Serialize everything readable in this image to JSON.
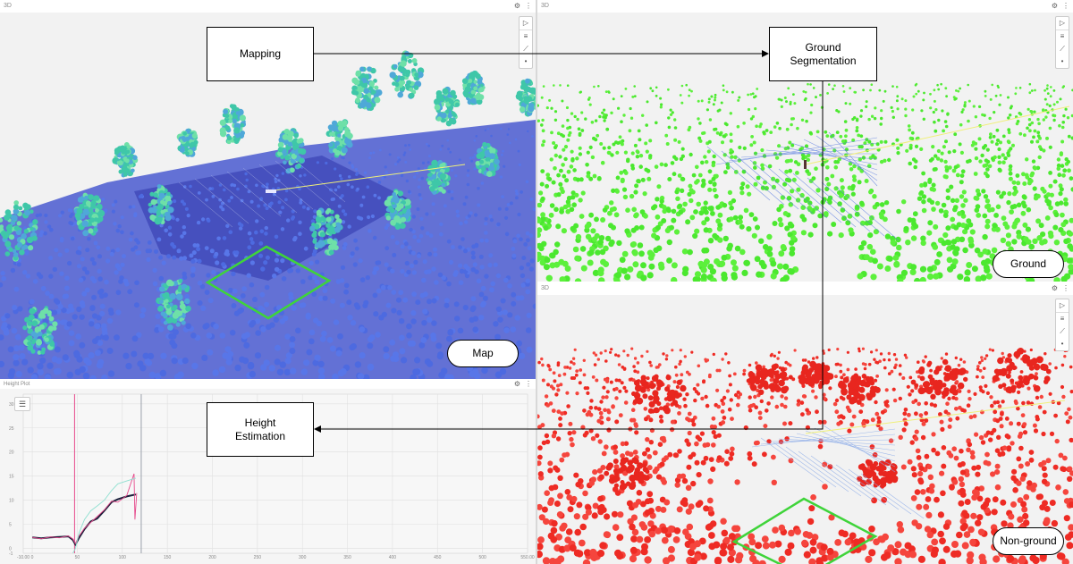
{
  "panels": {
    "map": {
      "title": "3D",
      "label": "Map",
      "color": "#4a62d8"
    },
    "ground": {
      "title": "3D",
      "label": "Ground",
      "color": "#44e82e"
    },
    "nonground": {
      "title": "3D",
      "label": "Non-ground",
      "color": "#ee2b24"
    },
    "height_plot": {
      "title": "Height Plot"
    }
  },
  "header_icons": {
    "settings": "⚙",
    "more": "⋮"
  },
  "toolbar_icons": [
    "cursor-icon",
    "layers-icon",
    "ruler-icon",
    "dot-icon"
  ],
  "pipeline": {
    "mapping": "Mapping",
    "ground_segmentation_line1": "Ground",
    "ground_segmentation_line2": "Segmentation",
    "height_estimation_line1": "Height",
    "height_estimation_line2": "Estimation"
  },
  "chart_data": {
    "type": "line",
    "x_ticks": [
      "-10.00",
      "0",
      "50",
      "100",
      "150",
      "200",
      "250",
      "300",
      "350",
      "400",
      "450",
      "500",
      "550.00"
    ],
    "y_ticks": [
      "30",
      "25",
      "20",
      "15",
      "10",
      "5",
      "0",
      "-1"
    ],
    "xlim": [
      -10,
      550
    ],
    "ylim": [
      -1,
      32
    ],
    "series": [
      {
        "color": "#1a1f3a",
        "x": [
          0,
          10,
          20,
          30,
          40,
          45,
          48,
          52,
          58,
          65,
          72,
          80,
          88,
          95,
          105,
          115
        ],
        "y": [
          2.3,
          2.1,
          2.3,
          2.4,
          2.5,
          1.8,
          0.8,
          2.2,
          4.0,
          5.6,
          6.2,
          7.8,
          9.6,
          10.2,
          10.8,
          11.2
        ]
      },
      {
        "color": "#e64b8c",
        "x": [
          0,
          10,
          20,
          30,
          40,
          45,
          48,
          52,
          58,
          65,
          72,
          80,
          88,
          95,
          105,
          113,
          114,
          116
        ],
        "y": [
          2.3,
          2.0,
          2.4,
          2.2,
          2.6,
          2.0,
          1.0,
          2.6,
          4.2,
          5.4,
          6.6,
          8.0,
          9.8,
          9.6,
          11.0,
          15.5,
          6.0,
          11.5
        ]
      },
      {
        "color": "#8fe0d0",
        "x": [
          45,
          48,
          52,
          58,
          65,
          72,
          80,
          88,
          95,
          105,
          115
        ],
        "y": [
          -1,
          0,
          3.2,
          6.0,
          7.8,
          8.8,
          10.0,
          12.0,
          13.4,
          14.0,
          14.6
        ]
      }
    ],
    "markers": [
      {
        "x": 47,
        "color": "#e64b8c"
      },
      {
        "x": 121,
        "color": "#9aa0aa"
      }
    ]
  }
}
